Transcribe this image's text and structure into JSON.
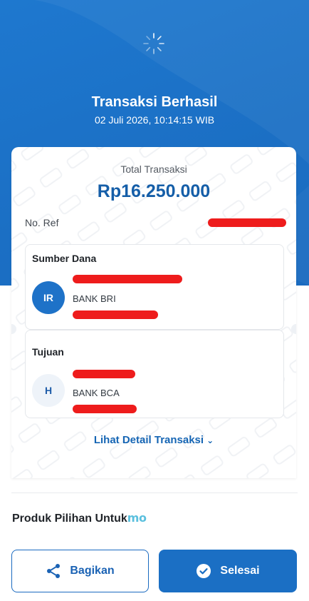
{
  "header": {
    "title": "Transaksi Berhasil",
    "datetime": "02 Juli 2026, 10:14:15 WIB"
  },
  "summary": {
    "total_label": "Total Transaksi",
    "total_amount": "Rp16.250.000",
    "ref_label": "No. Ref"
  },
  "source": {
    "section_title": "Sumber Dana",
    "avatar_initials": "IR",
    "bank": "BANK BRI"
  },
  "destination": {
    "section_title": "Tujuan",
    "avatar_initials": "H",
    "bank": "BANK BCA"
  },
  "detail_link": {
    "label": "Lihat Detail Transaksi"
  },
  "recommendation": {
    "label": "Produk Pilihan Untuk",
    "brand": "mo"
  },
  "actions": {
    "share_label": "Bagikan",
    "done_label": "Selesai"
  },
  "colors": {
    "primary": "#1b6fc4",
    "amount": "#155ea8",
    "redaction": "#ee1c1c",
    "brand_mo": "#5bc0de"
  },
  "icons": [
    "loading-spinner-icon",
    "chevron-down-icon",
    "share-icon",
    "check-circle-icon"
  ]
}
